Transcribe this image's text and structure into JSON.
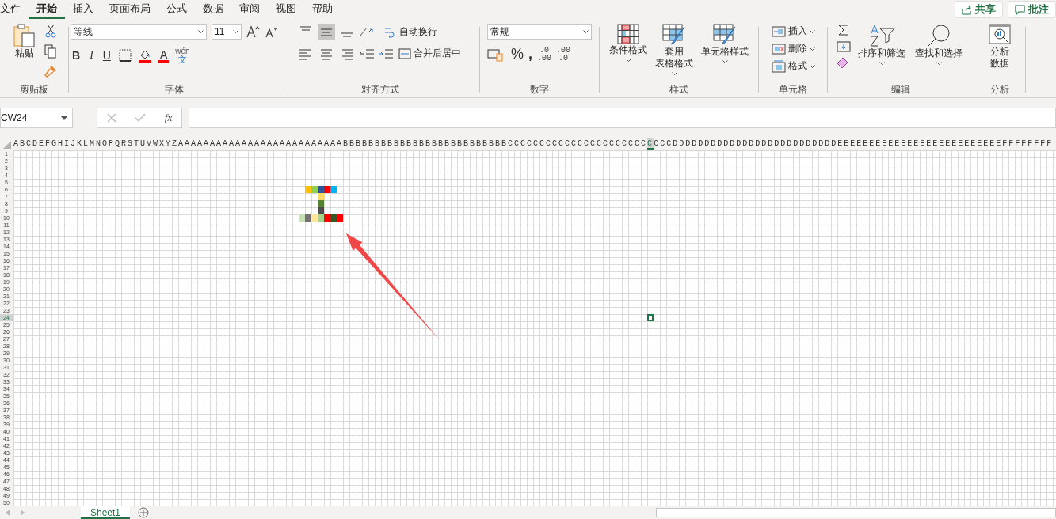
{
  "menu_tabs": [
    {
      "label": "文件",
      "selected": false
    },
    {
      "label": "开始",
      "selected": true
    },
    {
      "label": "插入",
      "selected": false
    },
    {
      "label": "页面布局",
      "selected": false
    },
    {
      "label": "公式",
      "selected": false
    },
    {
      "label": "数据",
      "selected": false
    },
    {
      "label": "审阅",
      "selected": false
    },
    {
      "label": "视图",
      "selected": false
    },
    {
      "label": "帮助",
      "selected": false
    }
  ],
  "header_buttons": [
    {
      "label": "共享",
      "kind": "share"
    },
    {
      "label": "批注",
      "kind": "comment"
    }
  ],
  "ribbon": {
    "clipboard": {
      "paste": "粘贴",
      "label": "剪贴板"
    },
    "font": {
      "name": "等线",
      "size": "11",
      "bold": "B",
      "italic": "I",
      "underline": "U",
      "font_color": "A",
      "phonetic_top": "wén",
      "phonetic_bottom": "文",
      "label": "字体"
    },
    "alignment": {
      "vertical": [
        {
          "selected": false
        },
        {
          "selected": true
        },
        {
          "selected": false
        }
      ],
      "wrap": "自动换行",
      "merge": "合并后居中",
      "label": "对齐方式"
    },
    "number": {
      "format": "常规",
      "percent": "%",
      "comma": ",",
      "decimals": [
        {
          "top": ".0",
          "bottom": ".00"
        },
        {
          "top": ".00",
          "bottom": ".0"
        }
      ],
      "label": "数字"
    },
    "styles": {
      "items": [
        {
          "lines": [
            "条件格式"
          ],
          "kind": "conditional"
        },
        {
          "lines": [
            "套用",
            "表格格式"
          ],
          "kind": "table"
        },
        {
          "lines": [
            "单元格样式"
          ],
          "kind": "cell"
        }
      ],
      "label": "样式"
    },
    "cells": {
      "items": [
        {
          "label": "插入",
          "kind": "insert"
        },
        {
          "label": "删除",
          "kind": "delete"
        },
        {
          "label": "格式",
          "kind": "format"
        }
      ],
      "label": "单元格"
    },
    "editing": {
      "sort": "排序和筛选",
      "find": "查找和选择",
      "label": "编辑"
    },
    "analysis": {
      "button": [
        "分析",
        "数据"
      ],
      "label": "分析"
    }
  },
  "formula_bar": {
    "name_box": "CW24",
    "function_label": "fx"
  },
  "column_headers": [
    {
      "letters": "ABCDEFGHIJKLMNOPQRSTUVWXYZAAAAAAAAAAAAAAAAAAAAAAAAAABBBBBBBBBBBBBBBBBBBBBBBBBBCCCCCCCCCCCCCCCCCCCCCC",
      "selected": false
    },
    {
      "letters": "C",
      "selected": true
    },
    {
      "letters": "CCCDDDDDDDDDDDDDDDDDDDDDDDDDDEEEEEEEEEEEEEEEEEEEEEEEEEEFFFFFFFF",
      "selected": false
    }
  ],
  "row_headers": [
    {
      "labels": [
        "1",
        "2",
        "3",
        "4",
        "5",
        "6",
        "7",
        "8",
        "9",
        "10",
        "11",
        "12",
        "13",
        "14",
        "15",
        "16",
        "17",
        "18",
        "19",
        "20",
        "21",
        "22",
        "23"
      ],
      "selected": false
    },
    {
      "labels": [
        "24"
      ],
      "selected": true
    },
    {
      "labels": [
        "25",
        "26",
        "27",
        "28",
        "29",
        "30",
        "31",
        "32",
        "33",
        "34",
        "35",
        "36",
        "37",
        "38",
        "39",
        "40",
        "41",
        "42",
        "43",
        "44",
        "45",
        "46",
        "47",
        "48",
        "49",
        "50"
      ],
      "selected": false
    }
  ],
  "pixel_art": [
    [
      {
        "filled": false
      },
      {
        "filled": true,
        "color": "#ffc000"
      },
      {
        "filled": true,
        "color": "#92d050"
      },
      {
        "filled": true,
        "color": "#2f5597"
      },
      {
        "filled": true,
        "color": "#ff0000"
      },
      {
        "filled": true,
        "color": "#00b0f0"
      }
    ],
    [
      {
        "filled": false
      },
      {
        "filled": false
      },
      {
        "filled": false
      },
      {
        "filled": true,
        "color": "#ffd966"
      }
    ],
    [
      {
        "filled": false
      },
      {
        "filled": false
      },
      {
        "filled": false
      },
      {
        "filled": true,
        "color": "#548235"
      }
    ],
    [
      {
        "filled": false
      },
      {
        "filled": false
      },
      {
        "filled": false
      },
      {
        "filled": true,
        "color": "#4d4d4d"
      }
    ],
    [
      {
        "filled": true,
        "color": "#c5e0b4"
      },
      {
        "filled": true,
        "color": "#767171"
      },
      {
        "filled": true,
        "color": "#ffe699"
      },
      {
        "filled": true,
        "color": "#a9d18e"
      },
      {
        "filled": true,
        "color": "#ff0000"
      },
      {
        "filled": true,
        "color": "#375623"
      },
      {
        "filled": true,
        "color": "#ff0000"
      }
    ]
  ],
  "sheet_tabs": [
    {
      "label": "Sheet1",
      "selected": true
    }
  ]
}
